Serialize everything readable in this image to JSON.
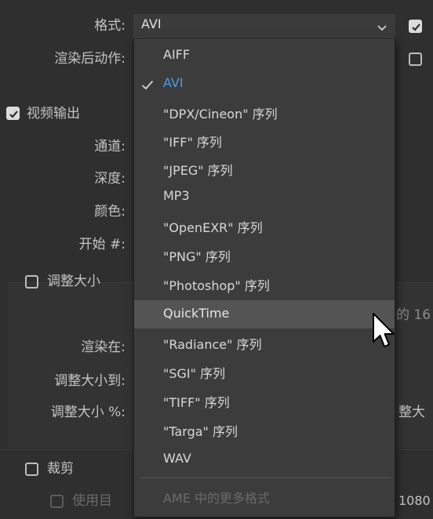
{
  "labels": {
    "format": "格式:",
    "post_render": "渲染后动作:",
    "video_output": "视频输出",
    "channel": "通道:",
    "depth": "深度:",
    "color": "颜色:",
    "start": "开始 #:",
    "resize": "调整大小",
    "render_at": "渲染在:",
    "resize_to": "调整大小到:",
    "resize_pct": "调整大小 %:",
    "crop": "裁剪",
    "use_target": "使用目",
    "right_partial_1": "的 16",
    "right_partial_2": "整大",
    "right_partial_3": "1080"
  },
  "format_select": {
    "value": "AVI"
  },
  "menu": {
    "items": [
      {
        "label": "AIFF",
        "state": "normal"
      },
      {
        "label": "AVI",
        "state": "selected"
      },
      {
        "label": "\"DPX/Cineon\" 序列",
        "state": "normal"
      },
      {
        "label": "\"IFF\" 序列",
        "state": "normal"
      },
      {
        "label": "\"JPEG\" 序列",
        "state": "normal"
      },
      {
        "label": "MP3",
        "state": "normal"
      },
      {
        "label": "\"OpenEXR\" 序列",
        "state": "normal"
      },
      {
        "label": "\"PNG\" 序列",
        "state": "normal"
      },
      {
        "label": "\"Photoshop\" 序列",
        "state": "normal"
      },
      {
        "label": "QuickTime",
        "state": "hover"
      },
      {
        "label": "\"Radiance\" 序列",
        "state": "normal"
      },
      {
        "label": "\"SGI\" 序列",
        "state": "normal"
      },
      {
        "label": "\"TIFF\" 序列",
        "state": "normal"
      },
      {
        "label": "\"Targa\" 序列",
        "state": "normal"
      },
      {
        "label": "WAV",
        "state": "normal"
      },
      {
        "label": "AME 中的更多格式",
        "state": "disabled"
      }
    ]
  },
  "icons": {
    "check": "checkmark-icon",
    "chevron": "chevron-down-icon",
    "cursor": "mouse-pointer-icon"
  },
  "colors": {
    "background": "#2f2f2f",
    "menu_bg": "#3c3c3c",
    "hover_bg": "#545454",
    "selected_text": "#4f9ae6"
  }
}
